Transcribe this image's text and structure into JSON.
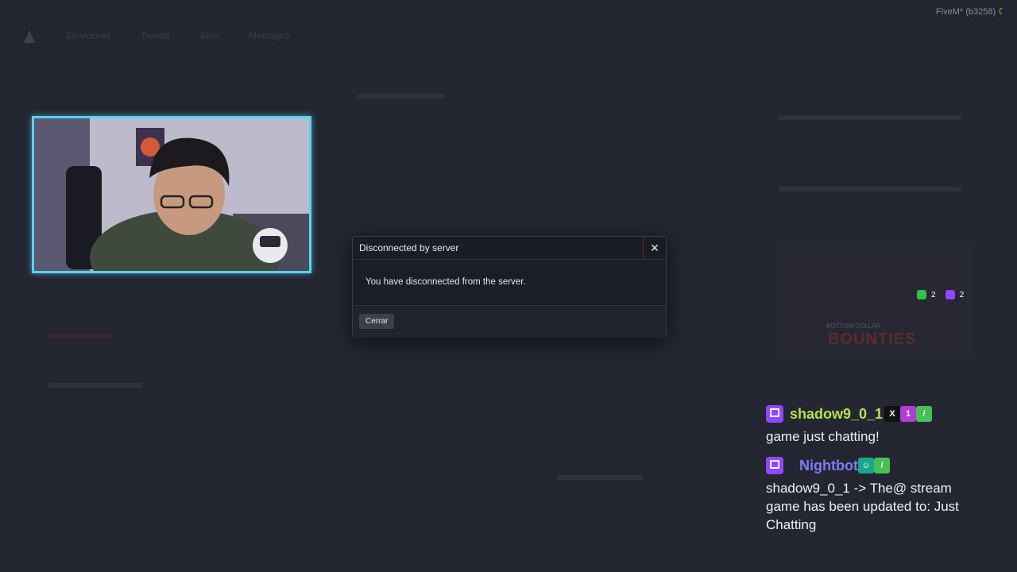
{
  "window": {
    "build_label": "FiveM* (b3258)"
  },
  "nav": {
    "items": [
      "Servidores",
      "Tienda",
      "Skin",
      "Mensajes"
    ]
  },
  "modal": {
    "title": "Disconnected by server",
    "message": "You have disconnected from the server.",
    "close_label": "Cerrar"
  },
  "promo": {
    "title": "BOUNTIES",
    "subtitle": "BOTTOM DOLLAR"
  },
  "stream_counter": {
    "xbox_count": "2",
    "twitch_count": "2"
  },
  "chat": {
    "messages": [
      {
        "user": "shadow9_0_1",
        "text": "game just chatting!",
        "user_color": "#b9e04a"
      },
      {
        "user": "Nightbot",
        "text": "shadow9_0_1 -> The@ stream game has been updated to: Just Chatting",
        "user_color": "#7f7cff"
      }
    ]
  },
  "colors": {
    "webcam_border": "#57d3f0",
    "twitch_purple": "#9146ff"
  }
}
